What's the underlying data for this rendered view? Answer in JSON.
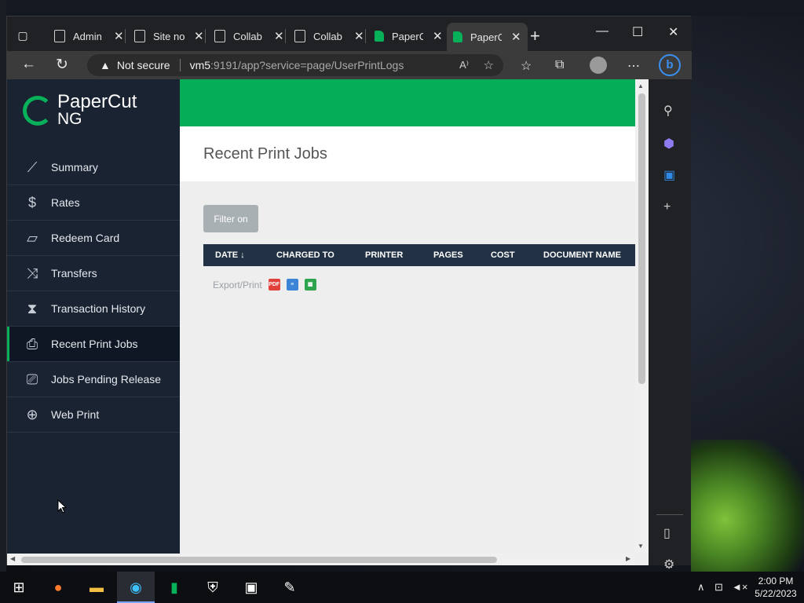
{
  "browser": {
    "tabs": [
      {
        "label": "Admin"
      },
      {
        "label": "Site no"
      },
      {
        "label": "Collab"
      },
      {
        "label": "Collab"
      },
      {
        "label": "PaperC"
      },
      {
        "label": "PaperC"
      }
    ],
    "security_label": "Not secure",
    "url_host": "vm5",
    "url_path": ":9191/app?service=page/UserPrintLogs"
  },
  "papercut": {
    "logo_line1": "PaperCut",
    "logo_line2": "NG",
    "nav": [
      {
        "label": "Summary",
        "icon": "chart-line-icon"
      },
      {
        "label": "Rates",
        "icon": "dollar-icon"
      },
      {
        "label": "Redeem Card",
        "icon": "card-icon"
      },
      {
        "label": "Transfers",
        "icon": "shuffle-icon"
      },
      {
        "label": "Transaction History",
        "icon": "hourglass-icon"
      },
      {
        "label": "Recent Print Jobs",
        "icon": "inbox-icon"
      },
      {
        "label": "Jobs Pending Release",
        "icon": "printer-clock-icon"
      },
      {
        "label": "Web Print",
        "icon": "globe-printer-icon"
      }
    ],
    "page_title": "Recent Print Jobs",
    "filter_label": "Filter on",
    "columns": [
      "DATE ↓",
      "CHARGED TO",
      "PRINTER",
      "PAGES",
      "COST",
      "DOCUMENT NAME"
    ],
    "export_label": "Export/Print",
    "export_pdf": "PDF"
  },
  "taskbar": {
    "time": "2:00 PM",
    "date": "5/22/2023"
  },
  "colors": {
    "brand_green": "#05ad58",
    "sidebar_bg": "#1a2332",
    "table_header": "#223244"
  }
}
